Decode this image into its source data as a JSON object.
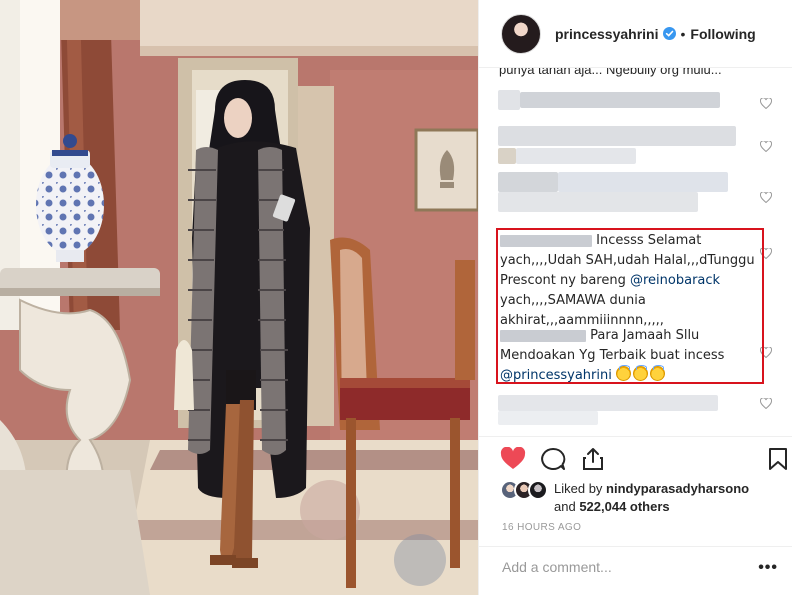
{
  "post": {
    "username": "princessyahrini",
    "separator": "•",
    "follow_label": "Following",
    "verified_icon": "verified-badge-icon"
  },
  "comments": {
    "cut_text": "punya tanah aja... Ngebully org mulu...",
    "highlighted": [
      {
        "text": "Incesss Selamat yach,,,,Udah SAH,udah Halal,,,dTunggu Prescont ny bareng ",
        "mention": "@reinobarack",
        "after": " yach,,,,SAMAWA dunia akhirat,,,aammiiinnnn,,,,,"
      },
      {
        "text": "Para Jamaah Sllu Mendoakan Yg Terbaik buat incess ",
        "mention": "@princessyahrini",
        "emoji_count": 3
      }
    ]
  },
  "likes": {
    "prefix": "Liked by ",
    "liker": "nindyparasadyharsono",
    "and": "and ",
    "count": "522,044 others"
  },
  "timestamp": "16 HOURS AGO",
  "add_comment": {
    "placeholder": "Add a comment..."
  },
  "colors": {
    "heart": "#ed4956",
    "mention": "#003569",
    "highlight_border": "#d8131d"
  }
}
